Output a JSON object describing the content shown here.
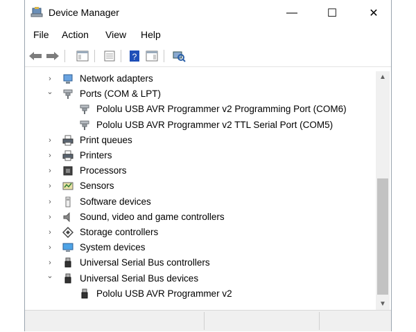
{
  "window": {
    "title": "Device Manager",
    "controls": {
      "minimize": "—",
      "maximize": "☐",
      "close": "✕"
    }
  },
  "menu": {
    "file": "File",
    "action": "Action",
    "view": "View",
    "help": "Help"
  },
  "tree": {
    "rows": [
      {
        "label": "Network adapters",
        "expander": "collapsed",
        "icon": "network-adapter-icon",
        "level": 0
      },
      {
        "label": "Ports (COM & LPT)",
        "expander": "expanded",
        "icon": "port-icon",
        "level": 0
      },
      {
        "label": "Pololu USB AVR Programmer v2 Programming Port (COM6)",
        "expander": "none",
        "icon": "port-icon",
        "level": 1
      },
      {
        "label": "Pololu USB AVR Programmer v2 TTL Serial Port (COM5)",
        "expander": "none",
        "icon": "port-icon",
        "level": 1
      },
      {
        "label": "Print queues",
        "expander": "collapsed",
        "icon": "printer-icon",
        "level": 0
      },
      {
        "label": "Printers",
        "expander": "collapsed",
        "icon": "printer-icon",
        "level": 0
      },
      {
        "label": "Processors",
        "expander": "collapsed",
        "icon": "processor-icon",
        "level": 0
      },
      {
        "label": "Sensors",
        "expander": "collapsed",
        "icon": "sensor-icon",
        "level": 0
      },
      {
        "label": "Software devices",
        "expander": "collapsed",
        "icon": "software-device-icon",
        "level": 0
      },
      {
        "label": "Sound, video and game controllers",
        "expander": "collapsed",
        "icon": "speaker-icon",
        "level": 0
      },
      {
        "label": "Storage controllers",
        "expander": "collapsed",
        "icon": "storage-controller-icon",
        "level": 0
      },
      {
        "label": "System devices",
        "expander": "collapsed",
        "icon": "monitor-icon",
        "level": 0
      },
      {
        "label": "Universal Serial Bus controllers",
        "expander": "collapsed",
        "icon": "usb-icon",
        "level": 0
      },
      {
        "label": "Universal Serial Bus devices",
        "expander": "expanded",
        "icon": "usb-icon",
        "level": 0
      },
      {
        "label": "Pololu USB AVR Programmer v2",
        "expander": "none",
        "icon": "usb-icon",
        "level": 1
      }
    ]
  },
  "glyphs": {
    "chevron_collapsed": "›",
    "chevron_expanded": "⌄",
    "scroll_up": "▲",
    "scroll_down": "▼"
  },
  "colors": {
    "accent_blue": "#1f6fd1",
    "window_border": "#9aa4ae"
  }
}
